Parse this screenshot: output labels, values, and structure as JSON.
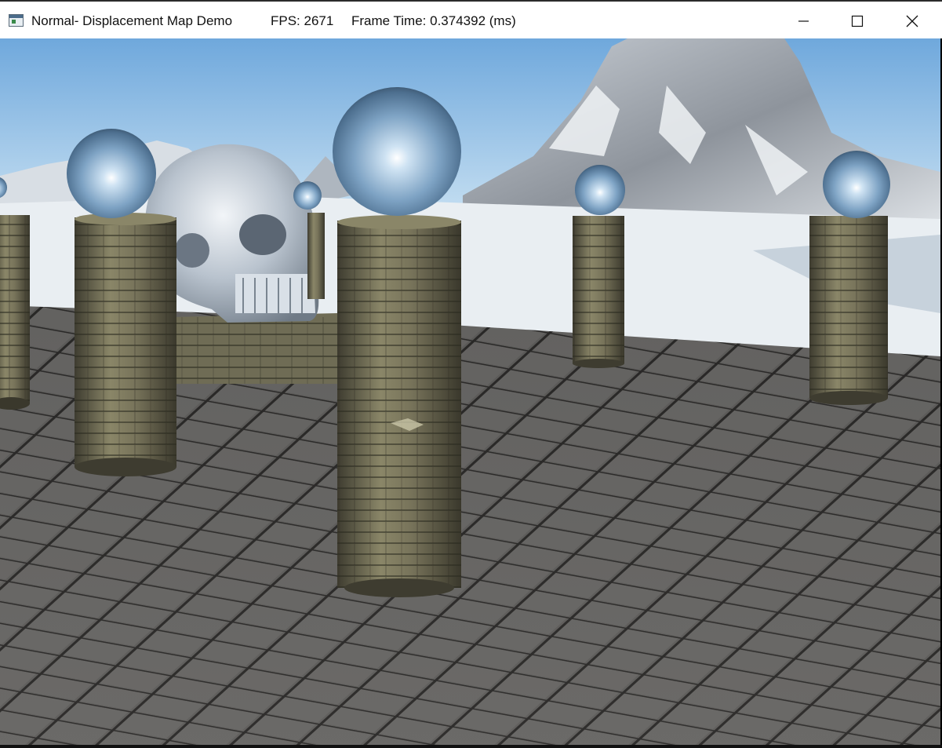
{
  "window": {
    "title": "Normal- Displacement Map Demo",
    "fps_text": "FPS: 2671",
    "frame_time_text": "Frame Time: 0.374392 (ms)"
  },
  "icons": {
    "app": "app-window-icon",
    "minimize": "minimize-icon",
    "maximize": "maximize-icon",
    "close": "close-icon"
  },
  "scene": {
    "sky_top": "#7fb3df",
    "sky_horizon": "#e6f1f8",
    "snow": "#e9eef2",
    "floor_tile": "#5f5e5c",
    "floor_grout": "#1d1c1b",
    "stone": "#6f6c55",
    "chrome": "#a9c5de",
    "skull": "#c9d2dc"
  }
}
